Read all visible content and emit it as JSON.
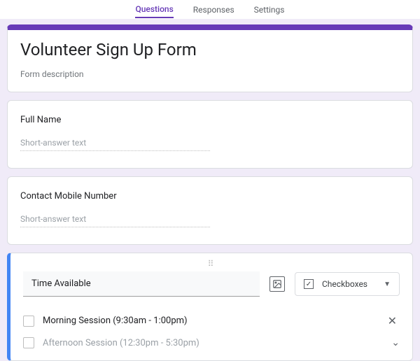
{
  "tabs": {
    "questions": "Questions",
    "responses": "Responses",
    "settings": "Settings"
  },
  "form": {
    "title": "Volunteer Sign Up Form",
    "description": "Form description"
  },
  "short_answer_placeholder": "Short-answer text",
  "q1": {
    "label": "Full Name"
  },
  "q2": {
    "label": "Contact Mobile Number"
  },
  "q3": {
    "label": "Time Available",
    "type_label": "Checkboxes",
    "options": [
      "Morning Session (9:30am - 1:00pm)",
      "Afternoon Session (12:30pm - 5:30pm)"
    ]
  }
}
